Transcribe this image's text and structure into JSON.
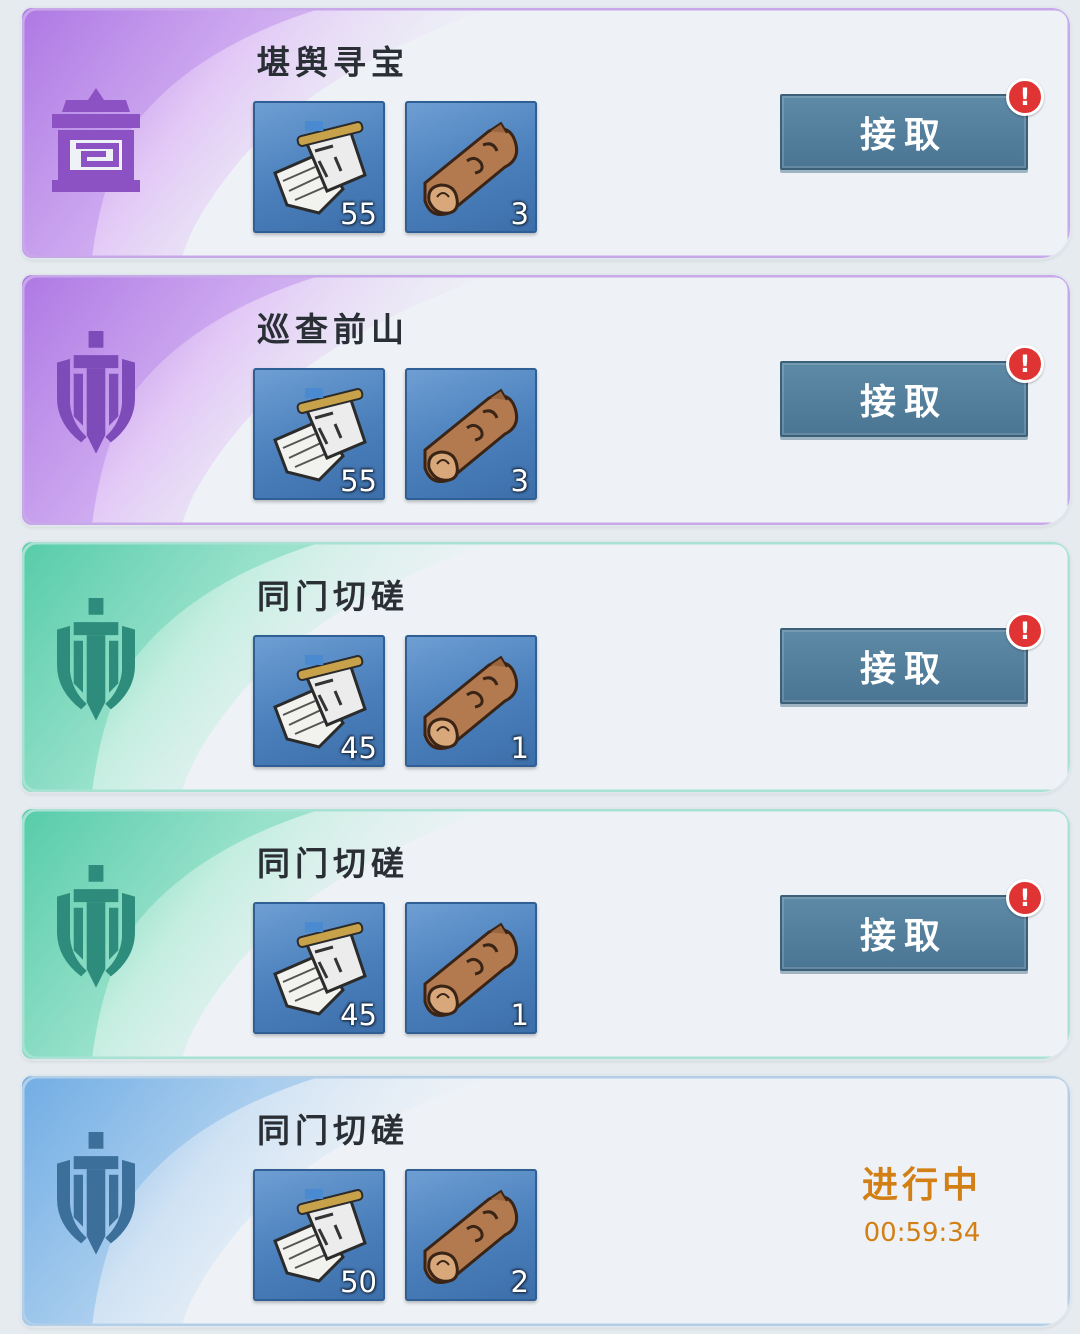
{
  "colors": {
    "purple_theme": "#b084e6",
    "teal_theme": "#5fd0b0",
    "blue_theme": "#7ab3e6",
    "accept_button": "#4f7c99",
    "alert_badge": "#e03434",
    "in_progress": "#d27f16"
  },
  "quests": [
    {
      "title": "堪舆寻宝",
      "theme": "purple",
      "emblem": "treasure-emblem-icon",
      "rewards": [
        {
          "icon": "scroll-icon",
          "qty": "55"
        },
        {
          "icon": "wood-log-icon",
          "qty": "3"
        }
      ],
      "button_label": "接取",
      "alert": "!"
    },
    {
      "title": "巡查前山",
      "theme": "purple",
      "emblem": "sword-shield-emblem-icon",
      "rewards": [
        {
          "icon": "scroll-icon",
          "qty": "55"
        },
        {
          "icon": "wood-log-icon",
          "qty": "3"
        }
      ],
      "button_label": "接取",
      "alert": "!"
    },
    {
      "title": "同门切磋",
      "theme": "teal",
      "emblem": "sword-shield-emblem-icon",
      "rewards": [
        {
          "icon": "scroll-icon",
          "qty": "45"
        },
        {
          "icon": "wood-log-icon",
          "qty": "1"
        }
      ],
      "button_label": "接取",
      "alert": "!"
    },
    {
      "title": "同门切磋",
      "theme": "teal",
      "emblem": "sword-shield-emblem-icon",
      "rewards": [
        {
          "icon": "scroll-icon",
          "qty": "45"
        },
        {
          "icon": "wood-log-icon",
          "qty": "1"
        }
      ],
      "button_label": "接取",
      "alert": "!"
    },
    {
      "title": "同门切磋",
      "theme": "blue",
      "emblem": "sword-shield-emblem-icon",
      "rewards": [
        {
          "icon": "scroll-icon",
          "qty": "50"
        },
        {
          "icon": "wood-log-icon",
          "qty": "2"
        }
      ],
      "status": "进行中",
      "timer": "00:59:34"
    }
  ]
}
